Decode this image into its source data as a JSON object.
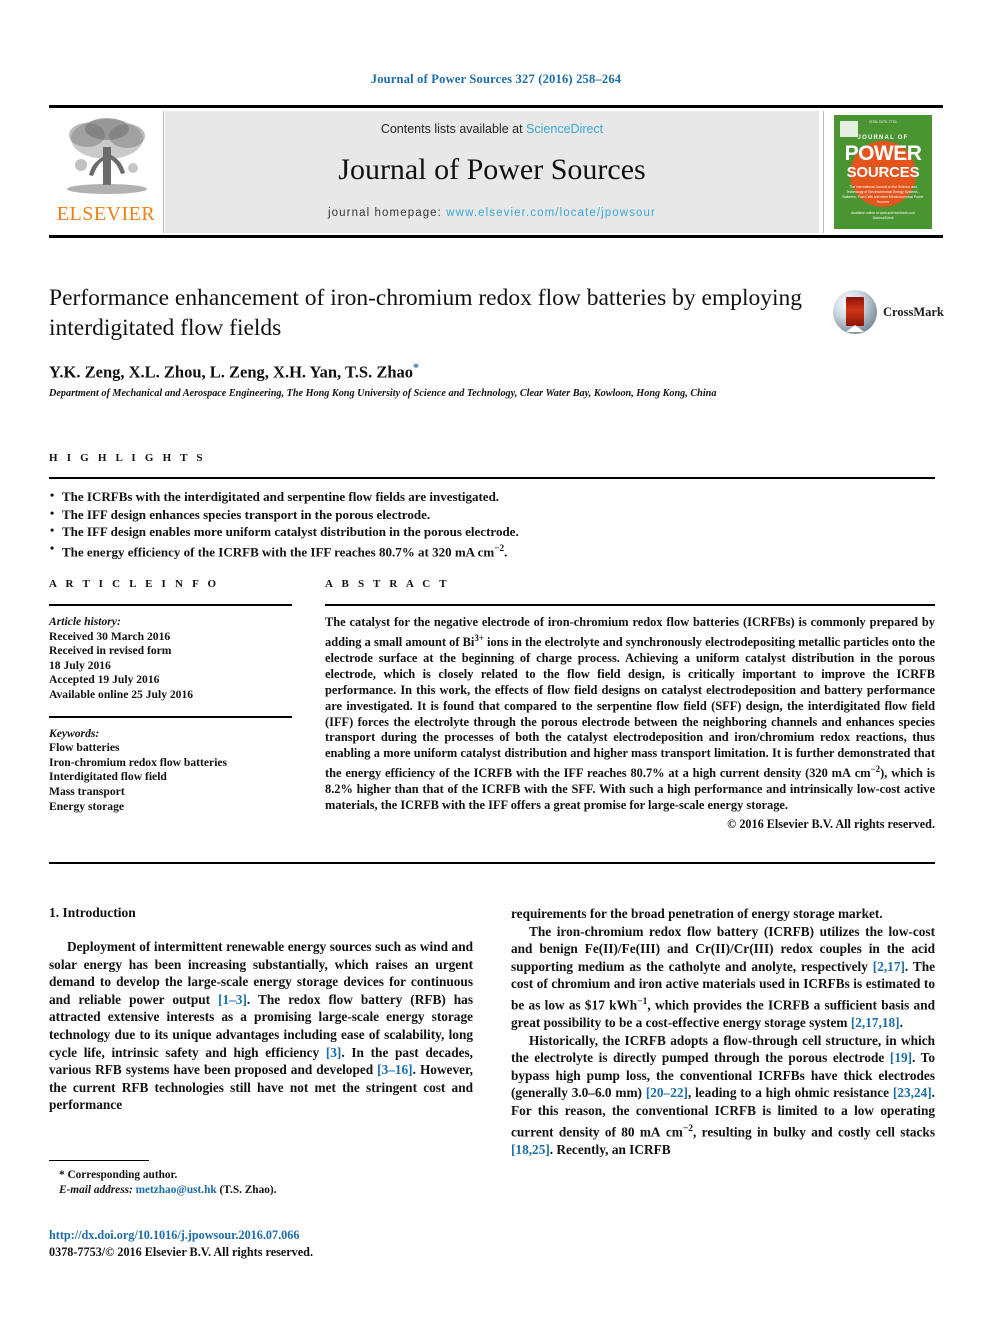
{
  "running_head": "Journal of Power Sources 327 (2016) 258–264",
  "masthead": {
    "publisher": "ELSEVIER",
    "contents_prefix": "Contents lists available at ",
    "contents_link": "ScienceDirect",
    "journal_name": "Journal of Power Sources",
    "homepage_prefix": "journal homepage: ",
    "homepage_url": "www.elsevier.com/locate/jpowsour",
    "cover": {
      "top_text": "ISSN 0378-7753",
      "journal_of": "JOURNAL OF",
      "power": "POWER",
      "sources": "SOURCES",
      "blurb": "The International Journal on the Science and Technology of Electrochemical Energy Systems - Batteries, Fuel Cells and other Electrochemical Power Sources",
      "bottom": "Available online at www.sciencedirect.com  ScienceDirect"
    }
  },
  "article": {
    "title": "Performance enhancement of iron-chromium redox flow batteries by employing interdigitated flow fields",
    "authors": "Y.K. Zeng, X.L. Zhou, L. Zeng, X.H. Yan, T.S. Zhao",
    "corresponding_marker": "*",
    "affiliation": "Department of Mechanical and Aerospace Engineering, The Hong Kong University of Science and Technology, Clear Water Bay, Kowloon, Hong Kong, China",
    "crossmark_label": "CrossMark"
  },
  "highlights": {
    "heading": "H I G H L I G H T S",
    "items": [
      "The ICRFBs with the interdigitated and serpentine flow fields are investigated.",
      "The IFF design enhances species transport in the porous electrode.",
      "The IFF design enables more uniform catalyst distribution in the porous electrode.",
      "The energy efficiency of the ICRFB with the IFF reaches 80.7% at 320 mA cm⁻²."
    ]
  },
  "article_info": {
    "heading": "A R T I C L E   I N F O",
    "history_label": "Article history:",
    "history": [
      "Received 30 March 2016",
      "Received in revised form",
      "18 July 2016",
      "Accepted 19 July 2016",
      "Available online 25 July 2016"
    ],
    "keywords_label": "Keywords:",
    "keywords": [
      "Flow batteries",
      "Iron-chromium redox flow batteries",
      "Interdigitated flow field",
      "Mass transport",
      "Energy storage"
    ]
  },
  "abstract": {
    "heading": "A B S T R A C T",
    "text": "The catalyst for the negative electrode of iron-chromium redox flow batteries (ICRFBs) is commonly prepared by adding a small amount of Bi3+ ions in the electrolyte and synchronously electrodepositing metallic particles onto the electrode surface at the beginning of charge process. Achieving a uniform catalyst distribution in the porous electrode, which is closely related to the flow field design, is critically important to improve the ICRFB performance. In this work, the effects of flow field designs on catalyst electrodeposition and battery performance are investigated. It is found that compared to the serpentine flow field (SFF) design, the interdigitated flow field (IFF) forces the electrolyte through the porous electrode between the neighboring channels and enhances species transport during the processes of both the catalyst electrodeposition and iron/chromium redox reactions, thus enabling a more uniform catalyst distribution and higher mass transport limitation. It is further demonstrated that the energy efficiency of the ICRFB with the IFF reaches 80.7% at a high current density (320 mA cm-2), which is 8.2% higher than that of the ICRFB with the SFF. With such a high performance and intrinsically low-cost active materials, the ICRFB with the IFF offers a great promise for large-scale energy storage.",
    "copyright": "© 2016 Elsevier B.V. All rights reserved."
  },
  "body": {
    "section_number_title": "1.  Introduction",
    "left_paragraphs": [
      "Deployment of intermittent renewable energy sources such as wind and solar energy has been increasing substantially, which raises an urgent demand to develop the large-scale energy storage devices for continuous and reliable power output [1–3]. The redox flow battery (RFB) has attracted extensive interests as a promising large-scale energy storage technology due to its unique advantages including ease of scalability, long cycle life, intrinsic safety and high efficiency [3]. In the past decades, various RFB systems have been proposed and developed [3–16]. However, the current RFB technologies still have not met the stringent cost and performance"
    ],
    "right_paragraphs": [
      "requirements for the broad penetration of energy storage market.",
      "The iron-chromium redox flow battery (ICRFB) utilizes the low-cost and benign Fe(II)/Fe(III) and Cr(II)/Cr(III) redox couples in the acid supporting medium as the catholyte and anolyte, respectively [2,17]. The cost of chromium and iron active materials used in ICRFBs is estimated to be as low as $17 kWh-1, which provides the ICRFB a sufficient basis and great possibility to be a cost-effective energy storage system [2,17,18].",
      "Historically, the ICRFB adopts a flow-through cell structure, in which the electrolyte is directly pumped through the porous electrode [19]. To bypass high pump loss, the conventional ICRFBs have thick electrodes (generally 3.0–6.0 mm) [20–22], leading to a high ohmic resistance [23,24]. For this reason, the conventional ICRFB is limited to a low operating current density of 80 mA cm-2, resulting in bulky and costly cell stacks [18,25]. Recently, an ICRFB"
    ]
  },
  "footnote": {
    "corresponding": "* Corresponding author.",
    "email_label": "E-mail address:",
    "email": "metzhao@ust.hk",
    "email_suffix": "(T.S. Zhao)."
  },
  "footer": {
    "doi": "http://dx.doi.org/10.1016/j.jpowsour.2016.07.066",
    "issn_line": "0378-7753/© 2016 Elsevier B.V. All rights reserved."
  },
  "colors": {
    "link_blue": "#1b6ca8",
    "science_direct_blue": "#3aa6d6",
    "elsevier_orange": "#f07f13",
    "cover_green": "#4a9432",
    "cover_orange": "#e2561d"
  }
}
